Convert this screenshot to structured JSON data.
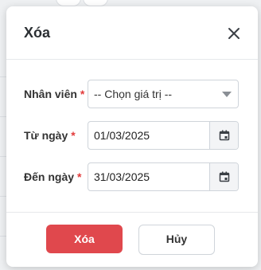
{
  "modal": {
    "title": "Xóa",
    "close_icon": "close-icon"
  },
  "form": {
    "employee": {
      "label": "Nhân viên",
      "required_mark": "*",
      "value": "-- Chọn giá trị --"
    },
    "from_date": {
      "label": "Từ ngày",
      "required_mark": "*",
      "value": "01/03/2025",
      "icon": "calendar-icon"
    },
    "to_date": {
      "label": "Đến ngày",
      "required_mark": "*",
      "value": "31/03/2025",
      "icon": "calendar-icon"
    }
  },
  "footer": {
    "delete_label": "Xóa",
    "cancel_label": "Hủy"
  },
  "colors": {
    "danger": "#e0484d",
    "required": "#e23b3b"
  }
}
